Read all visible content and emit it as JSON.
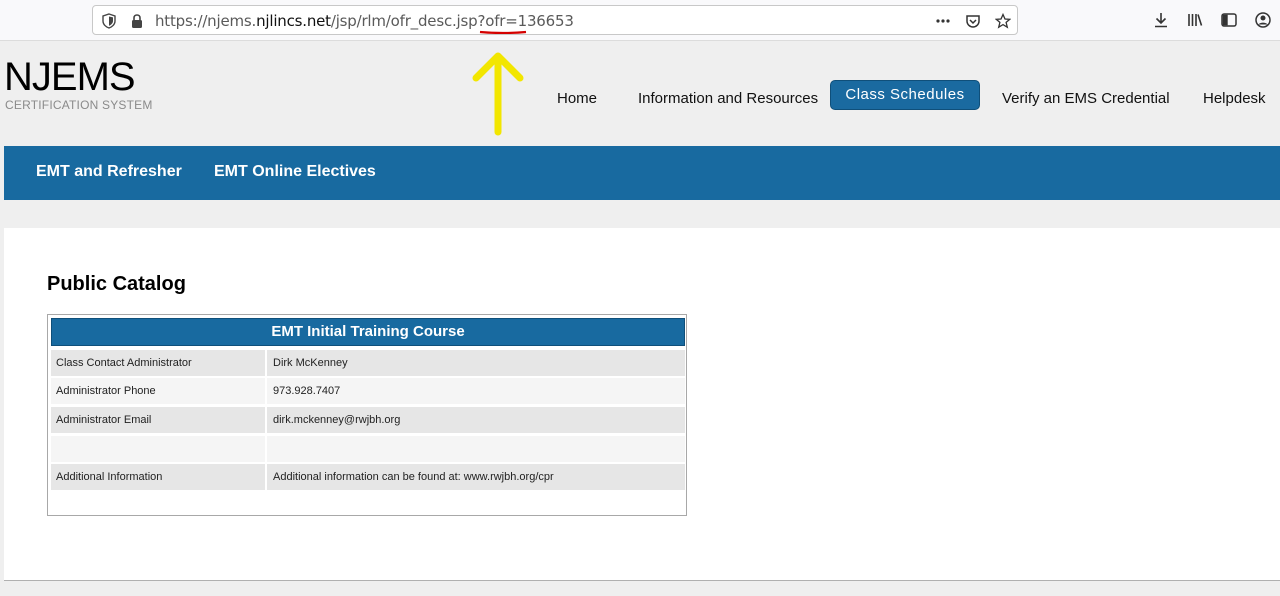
{
  "browser": {
    "url_prefix": "https://njems.",
    "url_domain": "njlincs.net",
    "url_path": "/jsp/rlm/ofr_desc.jsp?ofr=",
    "url_ofr": "136653"
  },
  "site": {
    "logo_title": "NJEMS",
    "logo_subtitle": "CERTIFICATION SYSTEM"
  },
  "top_nav": {
    "home": "Home",
    "info": "Information and Resources",
    "class_schedules": "Class Schedules",
    "verify": "Verify an EMS Credential",
    "helpdesk": "Helpdesk"
  },
  "sub_nav": {
    "emt_refresher": "EMT and Refresher",
    "emt_online": "EMT Online Electives"
  },
  "catalog": {
    "title": "Public Catalog",
    "course_title": "EMT Initial Training Course",
    "rows": [
      {
        "label": "Class Contact Administrator",
        "value": "Dirk McKenney"
      },
      {
        "label": "Administrator Phone",
        "value": "973.928.7407"
      },
      {
        "label": "Administrator Email",
        "value": "dirk.mckenney@rwjbh.org"
      },
      {
        "label": "",
        "value": ""
      },
      {
        "label": "Additional Information",
        "value": "Additional information can be found at: www.rwjbh.org/cpr"
      }
    ]
  },
  "annotation": {
    "arrow_color": "#f2e600",
    "underline_color": "#d40000"
  },
  "colors": {
    "accent_blue": "#186aa0"
  }
}
